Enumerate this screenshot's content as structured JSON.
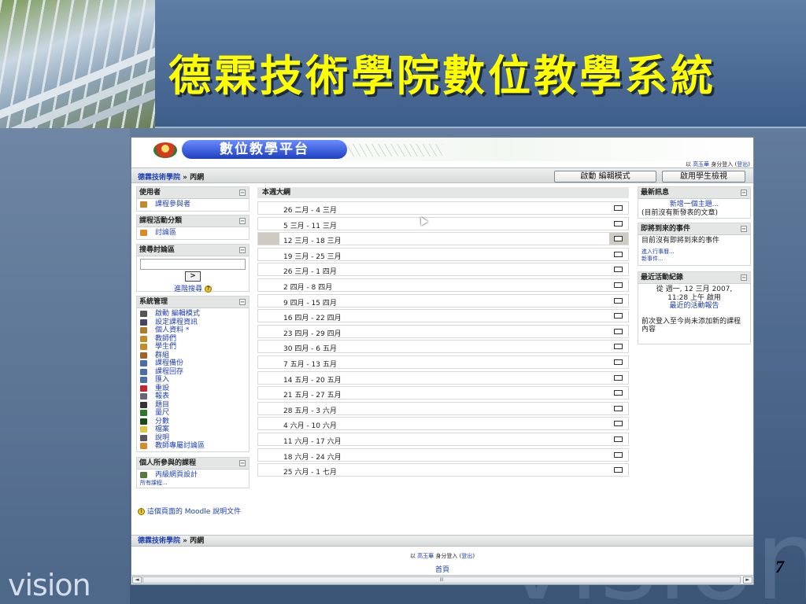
{
  "slide": {
    "title": "德霖技術學院數位教學系統",
    "logo_text": "vision",
    "page_number": "7",
    "background_watermark": "vision"
  },
  "site": {
    "banner_title": "數位教學平台",
    "login_prefix": "以",
    "user_name": "高玉華",
    "login_mid": "身分登入 (",
    "logout": "登出",
    "login_suffix": ")"
  },
  "navbar": {
    "crumb_root": "德霖技術學院",
    "separator": "»",
    "crumb_current": "丙網",
    "edit_mode_button": "啟動 編輯模式",
    "student_view_button": "啟用學生檢視"
  },
  "left": {
    "users": {
      "title": "使用者",
      "items": [
        "課程參與者"
      ]
    },
    "activities": {
      "title": "課程活動分類",
      "items": [
        "討論區"
      ]
    },
    "search": {
      "title": "搜尋討論區",
      "go": ">",
      "advanced": "進階搜尋"
    },
    "admin": {
      "title": "系統管理",
      "items": [
        "啟動 編輯模式",
        "設定課程資訊",
        "個人資料 *",
        "教師們",
        "學生們",
        "群組",
        "課程備份",
        "課程回存",
        "匯入",
        "重設",
        "報表",
        "題目",
        "量尺",
        "分數",
        "檔案",
        "說明",
        "教師專屬討論區"
      ]
    },
    "my_courses": {
      "title": "個人所參與的課程",
      "items": [
        "丙級網頁設計"
      ],
      "all_courses": "所有課程..."
    }
  },
  "outline": {
    "title": "本週大綱",
    "weeks": [
      "26 二月 - 4 三月",
      "5 三月 - 11 三月",
      "12 三月 - 18 三月",
      "19 三月 - 25 三月",
      "26 三月 - 1 四月",
      "2 四月 - 8 四月",
      "9 四月 - 15 四月",
      "16 四月 - 22 四月",
      "23 四月 - 29 四月",
      "30 四月 - 6 五月",
      "7 五月 - 13 五月",
      "14 五月 - 20 五月",
      "21 五月 - 27 五月",
      "28 五月 - 3 六月",
      "4 六月 - 10 六月",
      "11 六月 - 17 六月",
      "18 六月 - 24 六月",
      "25 六月 - 1 七月"
    ],
    "current_week_index": 2
  },
  "right": {
    "news": {
      "title": "最新訊息",
      "add_topic": "新增一個主題...",
      "none": "(目前沒有新發表的文章)"
    },
    "events": {
      "title": "即將到來的事件",
      "none": "目前沒有即將到來的事件",
      "go_calendar": "進入行事曆...",
      "new_event": "新事件..."
    },
    "recent": {
      "title": "最近活動紀錄",
      "since_line1": "從 週一, 12 三月 2007,",
      "since_line2": "11:28 上午 啟用",
      "full_report": "最近的活動報告",
      "nothing_new": "前次登入至今尚未添加新的課程內容"
    }
  },
  "footer": {
    "help_doc": "這個頁面的 Moodle 說明文件",
    "crumb_root": "德霖技術學院",
    "separator": "»",
    "crumb_current": "丙網",
    "home": "首頁",
    "scroll_grip": "III"
  },
  "colors": {
    "link": "#1f3fb0",
    "title_yellow": "#ffff00",
    "block_header": "#e3e6e5"
  }
}
